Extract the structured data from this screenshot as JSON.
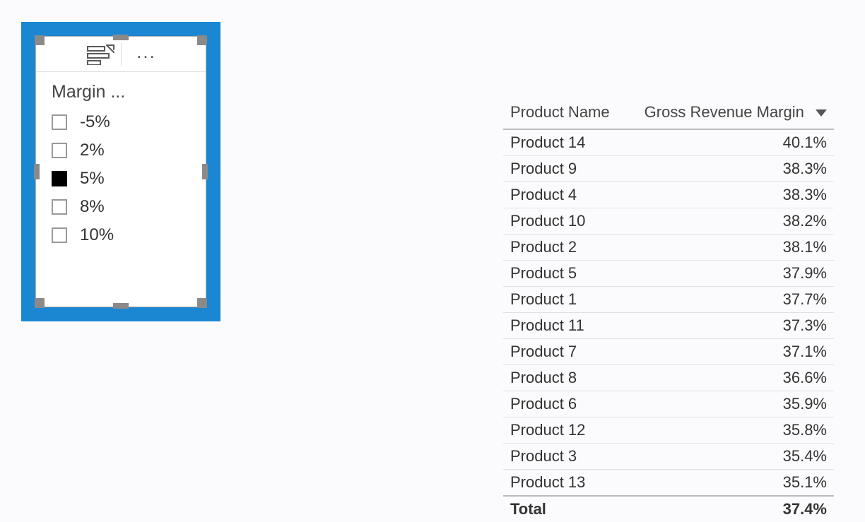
{
  "slicer": {
    "title": "Margin ...",
    "items": [
      {
        "label": "-5%",
        "checked": false
      },
      {
        "label": "2%",
        "checked": false
      },
      {
        "label": "5%",
        "checked": true
      },
      {
        "label": "8%",
        "checked": false
      },
      {
        "label": "10%",
        "checked": false
      }
    ],
    "iconName": "slicer-type-icon",
    "moreLabel": "..."
  },
  "table": {
    "columns": {
      "product": "Product Name",
      "margin": "Gross Revenue Margin"
    },
    "sort": {
      "column": "margin",
      "direction": "desc"
    },
    "rows": [
      {
        "product": "Product 14",
        "margin": "40.1%"
      },
      {
        "product": "Product 9",
        "margin": "38.3%"
      },
      {
        "product": "Product 4",
        "margin": "38.3%"
      },
      {
        "product": "Product 10",
        "margin": "38.2%"
      },
      {
        "product": "Product 2",
        "margin": "38.1%"
      },
      {
        "product": "Product 5",
        "margin": "37.9%"
      },
      {
        "product": "Product 1",
        "margin": "37.7%"
      },
      {
        "product": "Product 11",
        "margin": "37.3%"
      },
      {
        "product": "Product 7",
        "margin": "37.1%"
      },
      {
        "product": "Product 8",
        "margin": "36.6%"
      },
      {
        "product": "Product 6",
        "margin": "35.9%"
      },
      {
        "product": "Product 12",
        "margin": "35.8%"
      },
      {
        "product": "Product 3",
        "margin": "35.4%"
      },
      {
        "product": "Product 13",
        "margin": "35.1%"
      }
    ],
    "total": {
      "label": "Total",
      "margin": "37.4%"
    }
  }
}
